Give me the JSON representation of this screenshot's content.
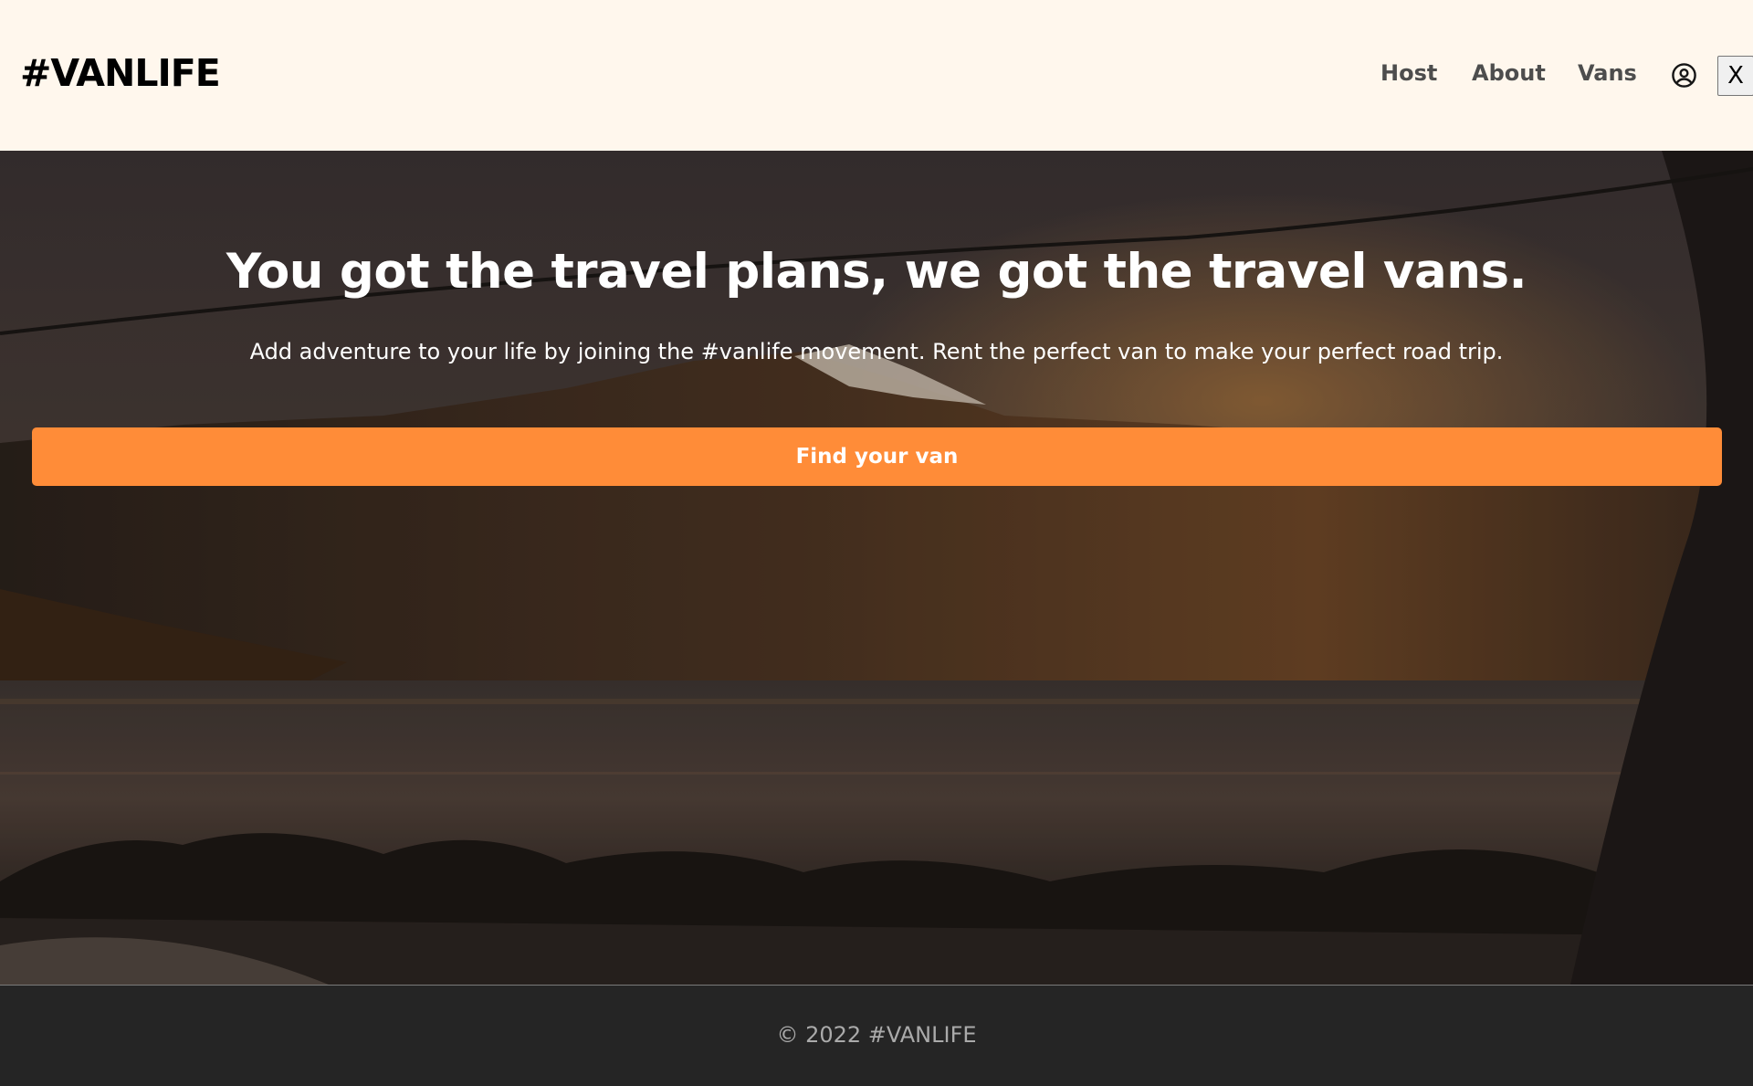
{
  "header": {
    "logo": "#VANLIFE",
    "nav": {
      "host": "Host",
      "about": "About",
      "vans": "Vans"
    },
    "close_label": "X",
    "user_icon": "user-circle-icon"
  },
  "hero": {
    "title": "You got the travel plans, we got the travel vans.",
    "subtitle": "Add adventure to your life by joining the #vanlife movement. Rent the perfect van to make your perfect road trip.",
    "cta_label": "Find your van"
  },
  "footer": {
    "copyright": "© 2022 #VANLIFE"
  },
  "colors": {
    "header_bg": "#FFF7ED",
    "cta": "#FF8C38",
    "footer_bg": "#252525"
  }
}
